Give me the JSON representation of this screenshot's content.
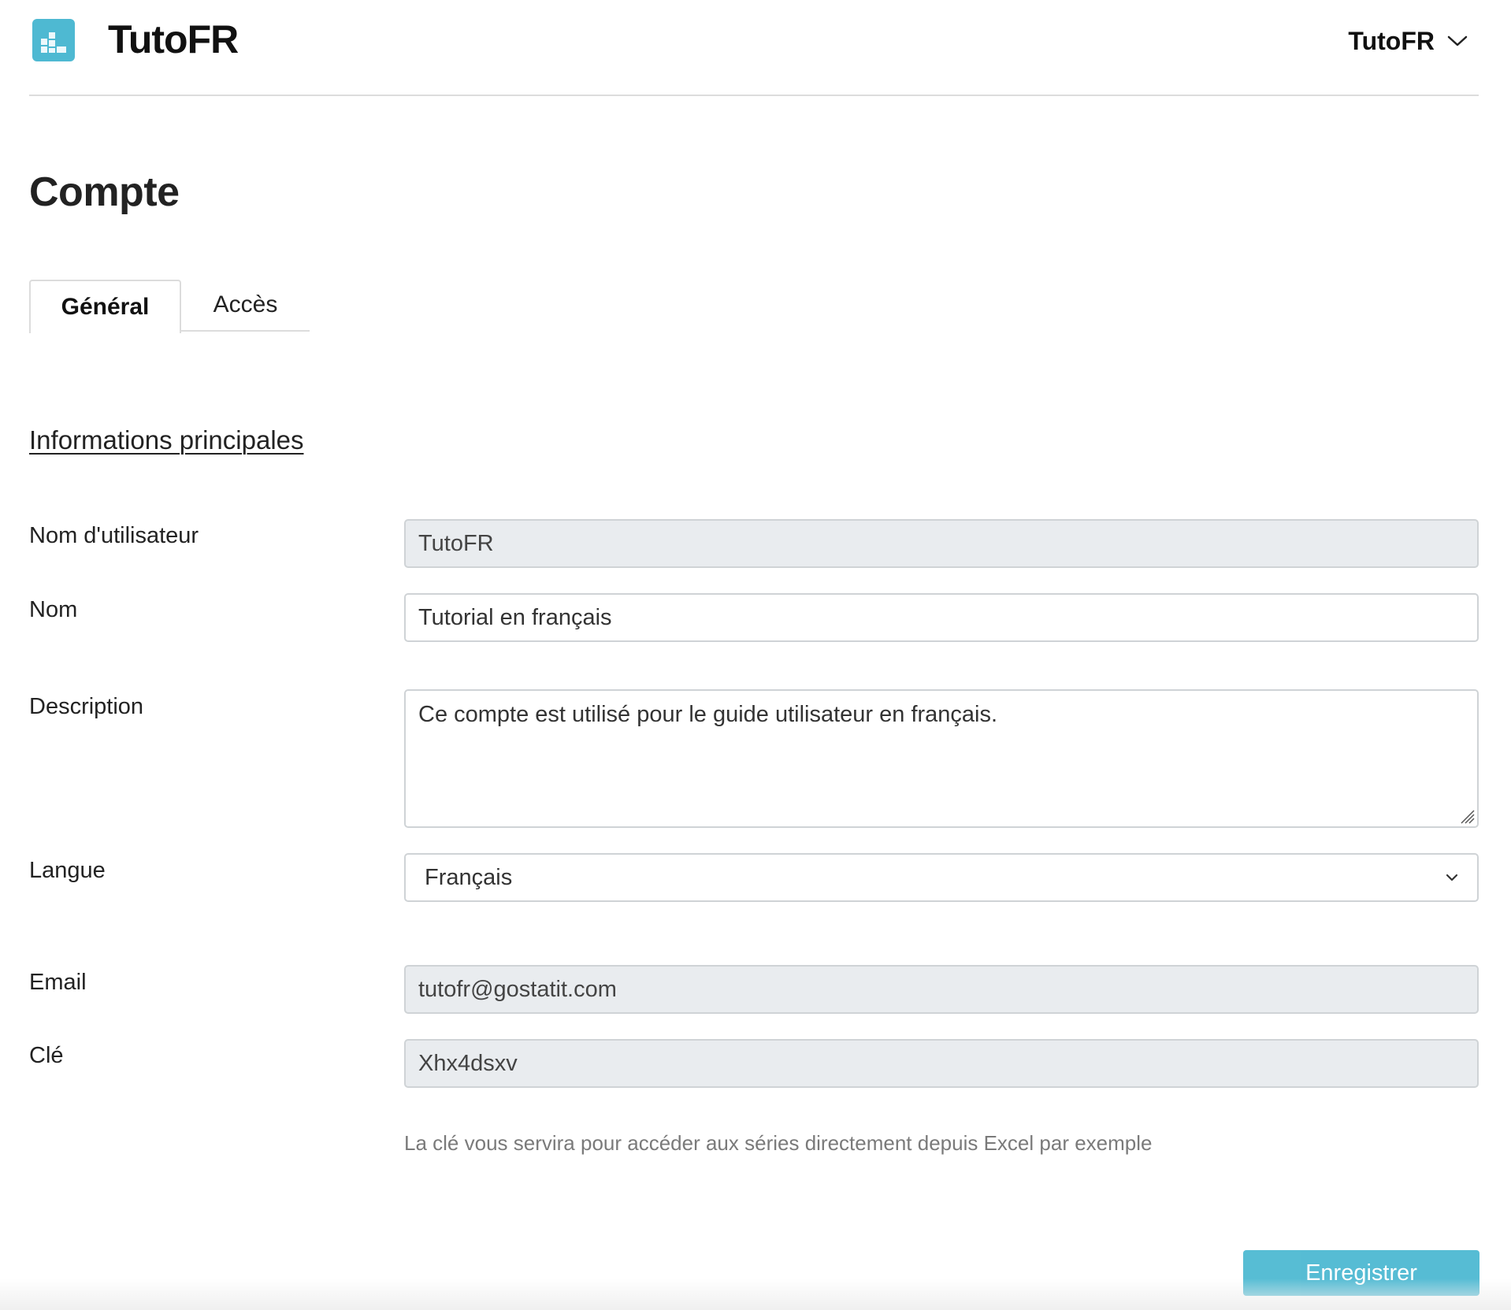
{
  "header": {
    "brand": "TutoFR",
    "user_menu_label": "TutoFR",
    "logo_icon": "bar-chart-logo-icon",
    "user_menu_icon": "chevron-down-icon"
  },
  "page": {
    "title": "Compte"
  },
  "tabs": [
    {
      "label": "Général",
      "active": true
    },
    {
      "label": "Accès",
      "active": false
    }
  ],
  "section": {
    "title": "Informations principales"
  },
  "form": {
    "username": {
      "label": "Nom d'utilisateur",
      "value": "TutoFR",
      "readonly": true
    },
    "name": {
      "label": "Nom",
      "value": "Tutorial en français",
      "readonly": false
    },
    "description": {
      "label": "Description",
      "value": "Ce compte est utilisé pour le guide utilisateur en français."
    },
    "language": {
      "label": "Langue",
      "selected": "Français"
    },
    "email": {
      "label": "Email",
      "value": "tutofr@gostatit.com",
      "readonly": true
    },
    "key": {
      "label": "Clé",
      "value": "Xhx4dsxv",
      "readonly": true
    },
    "key_help": "La clé vous servira pour accéder aux séries directement depuis Excel par exemple"
  },
  "actions": {
    "save_label": "Enregistrer"
  },
  "colors": {
    "accent": "#4eb9d2",
    "readonly_bg": "#e9ecef",
    "border": "#cfd3d6"
  }
}
